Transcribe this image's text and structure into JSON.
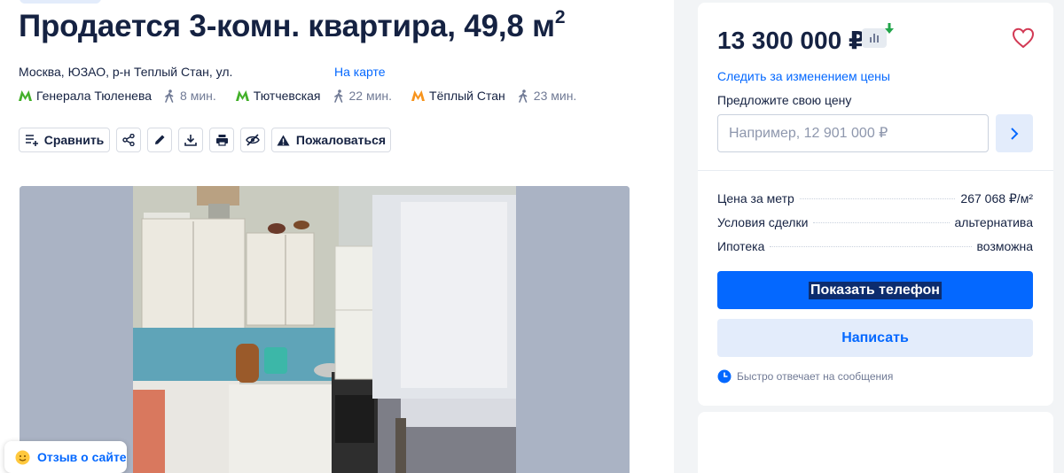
{
  "listing": {
    "title": "Продается 3-комн. квартира, 49,8 м",
    "title_sup": "2",
    "address": "Москва, ЮЗАО, р-н Теплый Стан, ул.",
    "map_link": "На карте",
    "metro": [
      {
        "station": "Генерала Тюленева",
        "time": "8 мин.",
        "color": "#43b02a"
      },
      {
        "station": "Тютчевская",
        "time": "22 мин.",
        "color": "#43b02a"
      },
      {
        "station": "Тёплый Стан",
        "time": "23 мин.",
        "color": "#f7941d"
      }
    ]
  },
  "actions": {
    "compare_label": "Сравнить",
    "complain_label": "Пожаловаться",
    "icons": [
      "share-icon",
      "edit-icon",
      "download-icon",
      "print-icon",
      "hide-icon"
    ]
  },
  "feedback": {
    "label": "Отзыв о сайте"
  },
  "sidebar": {
    "price": "13 300 000 ₽",
    "follow_price": "Следить за изменением цены",
    "offer_label": "Предложите свою цену",
    "offer_placeholder": "Например, 12 901 000 ₽",
    "facts": [
      {
        "label": "Цена за метр",
        "value": "267 068 ₽/м²"
      },
      {
        "label": "Условия сделки",
        "value": "альтернатива"
      },
      {
        "label": "Ипотека",
        "value": "возможна"
      }
    ],
    "show_phone": "Показать телефон",
    "write": "Написать",
    "quick_reply": "Быстро отвечает на сообщения"
  },
  "colors": {
    "accent": "#0468ff",
    "text": "#152242",
    "muted": "#707a95",
    "price_down": "#22a54b"
  }
}
